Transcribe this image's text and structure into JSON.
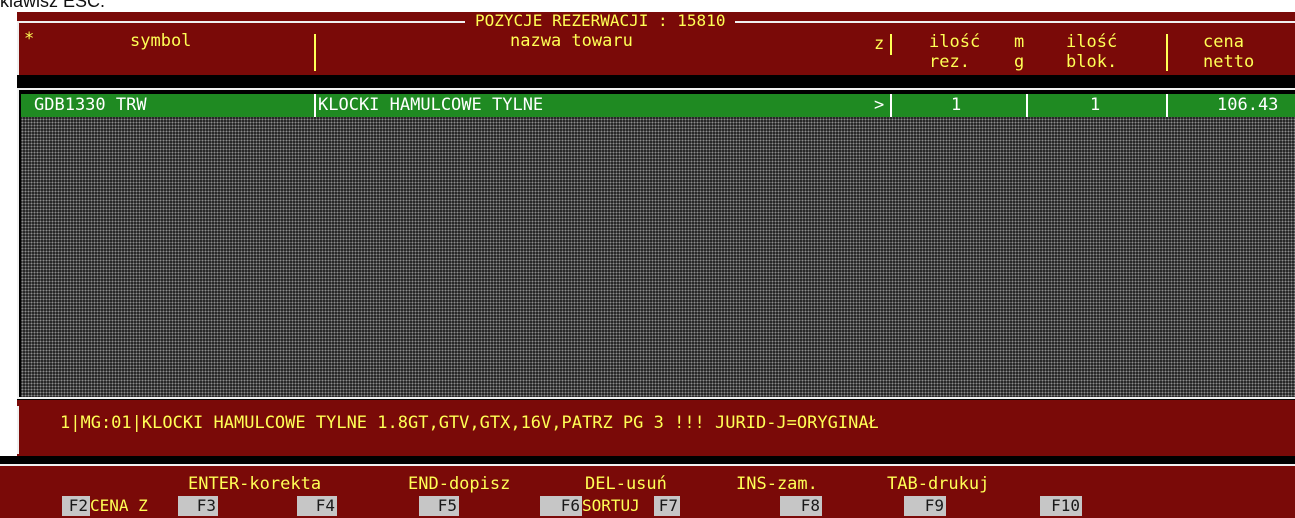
{
  "caption": "klawisz ESC.",
  "window": {
    "title": "POZYCJE REZERWACJI : 15810"
  },
  "columns": {
    "star": "*",
    "symbol": "symbol",
    "name": "nazwa towaru",
    "z": "z",
    "qty_res_1": "ilość",
    "qty_res_2": "rez.",
    "mg_1": "m",
    "mg_2": "g",
    "qty_blk_1": "ilość",
    "qty_blk_2": "blok.",
    "price_1": "cena",
    "price_2": "netto"
  },
  "rows": [
    {
      "symbol": "GDB1330 TRW",
      "name": "KLOCKI HAMULCOWE TYLNE",
      "z": ">",
      "qty_res": "1",
      "qty_blk": "1",
      "price": "106.43"
    }
  ],
  "info": {
    "text": "1|MG:01|KLOCKI HAMULCOWE TYLNE 1.8GT,GTV,GTX,16V,PATRZ PG 3 !!! JURID-J=ORYGINAŁ"
  },
  "hints": {
    "enter": "ENTER-korekta",
    "end": "END-dopisz",
    "del": "DEL-usuń",
    "ins": "INS-zam.",
    "tab": "TAB-drukuj"
  },
  "fkeys": {
    "f2": "F2",
    "f2_label": "CENA Z",
    "f3": "F3",
    "f4": "F4",
    "f5": "F5",
    "f6": "F6",
    "f6_label": "SORTUJ",
    "f7": "F7",
    "f8": "F8",
    "f9": "F9",
    "f10": "F10"
  },
  "colors": {
    "bg_red": "#7a0a08",
    "text_yellow": "#ffff55",
    "row_green": "#1f8a22",
    "key_gray": "#c6c6c6"
  }
}
